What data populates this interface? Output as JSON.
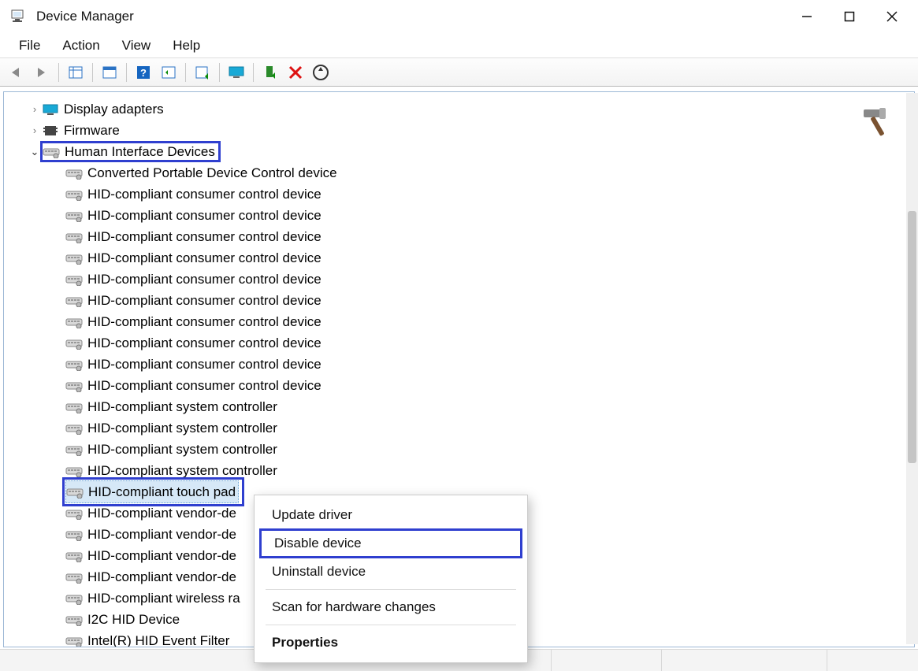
{
  "window": {
    "title": "Device Manager"
  },
  "menu": {
    "file": "File",
    "action": "Action",
    "view": "View",
    "help": "Help"
  },
  "toolbar_icons": [
    "back-arrow-icon",
    "forward-arrow-icon",
    "show-grid-icon",
    "properties-pane-icon",
    "help-icon",
    "refresh-icon",
    "update-driver-icon",
    "monitor-icon",
    "enable-device-icon",
    "disable-x-icon",
    "scan-hardware-icon"
  ],
  "categories": {
    "display_adapters": "Display adapters",
    "firmware": "Firmware",
    "hid": "Human Interface Devices"
  },
  "hid_children": [
    "Converted Portable Device Control device",
    "HID-compliant consumer control device",
    "HID-compliant consumer control device",
    "HID-compliant consumer control device",
    "HID-compliant consumer control device",
    "HID-compliant consumer control device",
    "HID-compliant consumer control device",
    "HID-compliant consumer control device",
    "HID-compliant consumer control device",
    "HID-compliant consumer control device",
    "HID-compliant consumer control device",
    "HID-compliant system controller",
    "HID-compliant system controller",
    "HID-compliant system controller",
    "HID-compliant system controller",
    "HID-compliant touch pad",
    "HID-compliant vendor-de",
    "HID-compliant vendor-de",
    "HID-compliant vendor-de",
    "HID-compliant vendor-de",
    "HID-compliant wireless ra",
    "I2C HID Device",
    "Intel(R) HID Event Filter"
  ],
  "selected_index": 15,
  "context_menu": {
    "update_driver": "Update driver",
    "disable_device": "Disable device",
    "uninstall_device": "Uninstall device",
    "scan_hardware": "Scan for hardware changes",
    "properties": "Properties"
  }
}
